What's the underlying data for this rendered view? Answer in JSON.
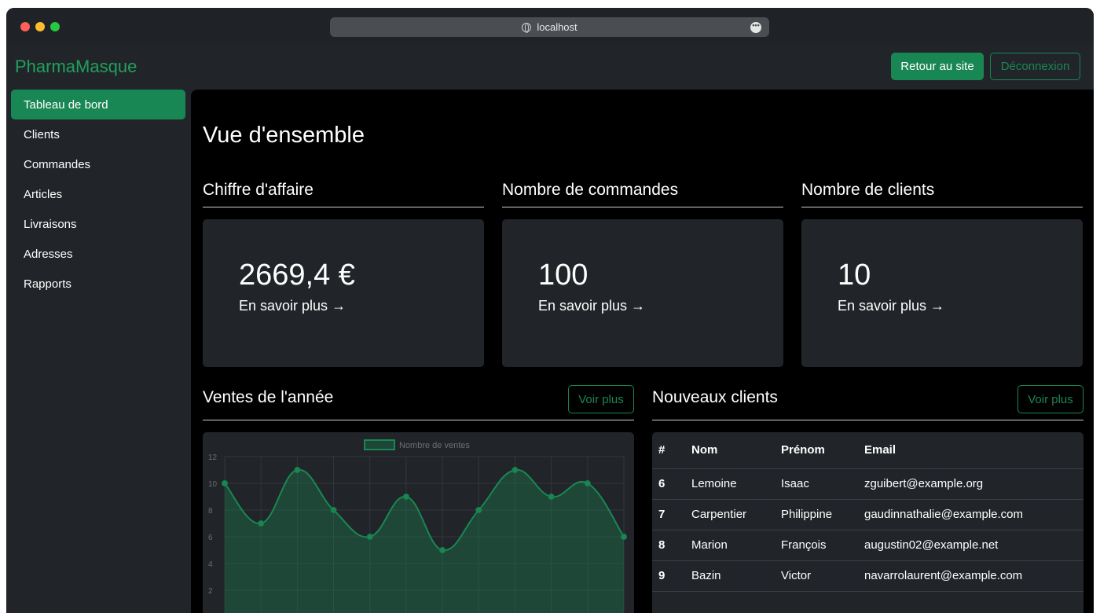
{
  "browser": {
    "url": "localhost"
  },
  "brand": "PharmaMasque",
  "header": {
    "back_label": "Retour au site",
    "logout_label": "Déconnexion"
  },
  "sidebar": {
    "items": [
      {
        "label": "Tableau de bord",
        "active": true
      },
      {
        "label": "Clients"
      },
      {
        "label": "Commandes"
      },
      {
        "label": "Articles"
      },
      {
        "label": "Livraisons"
      },
      {
        "label": "Adresses"
      },
      {
        "label": "Rapports"
      }
    ]
  },
  "main": {
    "title": "Vue d'ensemble",
    "stats": [
      {
        "heading": "Chiffre d'affaire",
        "value": "2669,4 €",
        "link": "En savoir plus →"
      },
      {
        "heading": "Nombre de commandes",
        "value": "100",
        "link": "En savoir plus →"
      },
      {
        "heading": "Nombre de clients",
        "value": "10",
        "link": "En savoir plus →"
      }
    ],
    "sales": {
      "heading": "Ventes de l'année",
      "more_label": "Voir plus"
    },
    "clients": {
      "heading": "Nouveaux clients",
      "more_label": "Voir plus",
      "columns": [
        "#",
        "Nom",
        "Prénom",
        "Email"
      ],
      "rows": [
        [
          "6",
          "Lemoine",
          "Isaac",
          "zguibert@example.org"
        ],
        [
          "7",
          "Carpentier",
          "Philippine",
          "gaudinnathalie@example.com"
        ],
        [
          "8",
          "Marion",
          "François",
          "augustin02@example.net"
        ],
        [
          "9",
          "Bazin",
          "Victor",
          "navarrolaurent@example.com"
        ]
      ]
    }
  },
  "chart_data": {
    "type": "line",
    "series": [
      {
        "name": "Nombre de ventes",
        "values": [
          10,
          7,
          11,
          8,
          6,
          9,
          5,
          8,
          11,
          9,
          10,
          6
        ]
      }
    ],
    "y_ticks": [
      "12",
      "10",
      "8",
      "6",
      "4",
      "2"
    ],
    "ylim": [
      0,
      12
    ],
    "grid": true,
    "legend": "top",
    "colors": {
      "line": "#198754",
      "fill": "rgba(25,135,84,0.35)"
    }
  },
  "colors": {
    "accent": "#198754",
    "background": "#000000",
    "panel": "#212529"
  }
}
